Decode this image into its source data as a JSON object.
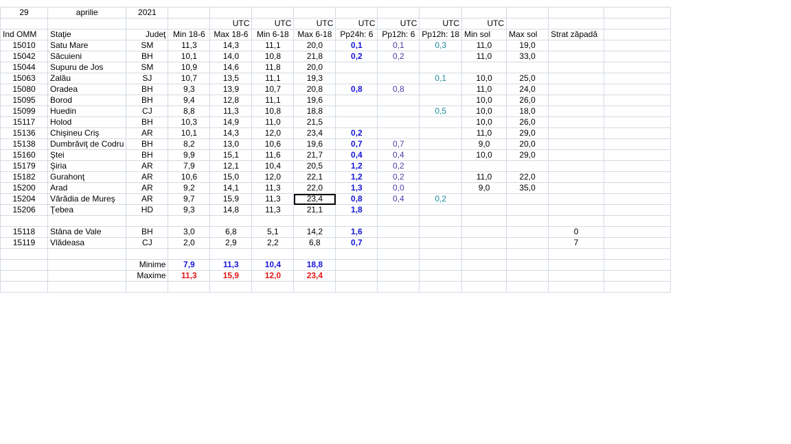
{
  "date": {
    "day": "29",
    "month": "aprilie",
    "year": "2021"
  },
  "utc_label": "UTC",
  "headers": [
    "Ind OMM",
    "Staţie",
    "Judeţ",
    "Min 18-6",
    "Max 18-6",
    "Min 6-18",
    "Max 6-18",
    "Pp24h: 6",
    "Pp12h: 6",
    "Pp12h: 18",
    "Min sol",
    "Max sol",
    "Strat zăpadă"
  ],
  "rows": [
    {
      "id": "15010",
      "station": "Satu Mare",
      "county": "SM",
      "min186": "11,3",
      "max186": "14,3",
      "min618": "11,1",
      "max618": "20,0",
      "pp24": "0,1",
      "pp12a": "0,1",
      "pp12b": "0,3",
      "minsol": "11,0",
      "maxsol": "19,0",
      "snow": ""
    },
    {
      "id": "15042",
      "station": "Săcuieni",
      "county": "BH",
      "min186": "10,1",
      "max186": "14,0",
      "min618": "10,8",
      "max618": "21,8",
      "pp24": "0,2",
      "pp12a": "0,2",
      "pp12b": "",
      "minsol": "11,0",
      "maxsol": "33,0",
      "snow": ""
    },
    {
      "id": "15044",
      "station": "Supuru de Jos",
      "county": "SM",
      "min186": "10,9",
      "max186": "14,6",
      "min618": "11,8",
      "max618": "20,0",
      "pp24": "",
      "pp12a": "",
      "pp12b": "",
      "minsol": "",
      "maxsol": "",
      "snow": ""
    },
    {
      "id": "15063",
      "station": "Zalău",
      "county": "SJ",
      "min186": "10,7",
      "max186": "13,5",
      "min618": "11,1",
      "max618": "19,3",
      "pp24": "",
      "pp12a": "",
      "pp12b": "0,1",
      "minsol": "10,0",
      "maxsol": "25,0",
      "snow": ""
    },
    {
      "id": "15080",
      "station": "Oradea",
      "county": "BH",
      "min186": "9,3",
      "max186": "13,9",
      "min618": "10,7",
      "max618": "20,8",
      "pp24": "0,8",
      "pp12a": "0,8",
      "pp12b": "",
      "minsol": "11,0",
      "maxsol": "24,0",
      "snow": ""
    },
    {
      "id": "15095",
      "station": "Borod",
      "county": "BH",
      "min186": "9,4",
      "max186": "12,8",
      "min618": "11,1",
      "max618": "19,6",
      "pp24": "",
      "pp12a": "",
      "pp12b": "",
      "minsol": "10,0",
      "maxsol": "26,0",
      "snow": ""
    },
    {
      "id": "15099",
      "station": "Huedin",
      "county": "CJ",
      "min186": "8,8",
      "max186": "11,3",
      "min618": "10,8",
      "max618": "18,8",
      "pp24": "",
      "pp12a": "",
      "pp12b": "0,5",
      "minsol": "10,0",
      "maxsol": "18,0",
      "snow": ""
    },
    {
      "id": "15117",
      "station": "Holod",
      "county": "BH",
      "min186": "10,3",
      "max186": "14,9",
      "min618": "11,0",
      "max618": "21,5",
      "pp24": "",
      "pp12a": "",
      "pp12b": "",
      "minsol": "10,0",
      "maxsol": "26,0",
      "snow": ""
    },
    {
      "id": "15136",
      "station": "Chişineu   Criş",
      "county": "AR",
      "min186": "10,1",
      "max186": "14,3",
      "min618": "12,0",
      "max618": "23,4",
      "pp24": "0,2",
      "pp12a": "",
      "pp12b": "",
      "minsol": "11,0",
      "maxsol": "29,0",
      "snow": ""
    },
    {
      "id": "15138",
      "station": "Dumbrăviţ  de Codru",
      "county": "BH",
      "min186": "8,2",
      "max186": "13,0",
      "min618": "10,6",
      "max618": "19,6",
      "pp24": "0,7",
      "pp12a": "0,7",
      "pp12b": "",
      "minsol": "9,0",
      "maxsol": "20,0",
      "snow": ""
    },
    {
      "id": "15160",
      "station": "Ştei",
      "county": "BH",
      "min186": "9,9",
      "max186": "15,1",
      "min618": "11,6",
      "max618": "21,7",
      "pp24": "0,4",
      "pp12a": "0,4",
      "pp12b": "",
      "minsol": "10,0",
      "maxsol": "29,0",
      "snow": ""
    },
    {
      "id": "15179",
      "station": "Şiria",
      "county": "AR",
      "min186": "7,9",
      "max186": "12,1",
      "min618": "10,4",
      "max618": "20,5",
      "pp24": "1,2",
      "pp12a": "0,2",
      "pp12b": "",
      "minsol": "",
      "maxsol": "",
      "snow": ""
    },
    {
      "id": "15182",
      "station": "Gurahonţ",
      "county": "AR",
      "min186": "10,6",
      "max186": "15,0",
      "min618": "12,0",
      "max618": "22,1",
      "pp24": "1,2",
      "pp12a": "0,2",
      "pp12b": "",
      "minsol": "11,0",
      "maxsol": "22,0",
      "snow": ""
    },
    {
      "id": "15200",
      "station": "Arad",
      "county": "AR",
      "min186": "9,2",
      "max186": "14,1",
      "min618": "11,3",
      "max618": "22,0",
      "pp24": "1,3",
      "pp12a": "0,0",
      "pp12b": "",
      "minsol": "9,0",
      "maxsol": "35,0",
      "snow": ""
    },
    {
      "id": "15204",
      "station": "Vărădia de Mureş",
      "county": "AR",
      "min186": "9,7",
      "max186": "15,9",
      "min618": "11,3",
      "max618": "23,4",
      "pp24": "0,8",
      "pp12a": "0,4",
      "pp12b": "0,2",
      "minsol": "",
      "maxsol": "",
      "snow": ""
    },
    {
      "id": "15206",
      "station": "Ţebea",
      "county": "HD",
      "min186": "9,3",
      "max186": "14,8",
      "min618": "11,3",
      "max618": "21,1",
      "pp24": "1,8",
      "pp12a": "",
      "pp12b": "",
      "minsol": "",
      "maxsol": "",
      "snow": ""
    },
    {
      "id": "",
      "station": "",
      "county": "",
      "min186": "",
      "max186": "",
      "min618": "",
      "max618": "",
      "pp24": "",
      "pp12a": "",
      "pp12b": "",
      "minsol": "",
      "maxsol": "",
      "snow": ""
    },
    {
      "id": "15118",
      "station": "Stâna de Vale",
      "county": "BH",
      "min186": "3,0",
      "max186": "6,8",
      "min618": "5,1",
      "max618": "14,2",
      "pp24": "1,6",
      "pp12a": "",
      "pp12b": "",
      "minsol": "",
      "maxsol": "",
      "snow": "0"
    },
    {
      "id": "15119",
      "station": "Vlădeasa",
      "county": "CJ",
      "min186": "2,0",
      "max186": "2,9",
      "min618": "2,2",
      "max618": "6,8",
      "pp24": "0,7",
      "pp12a": "",
      "pp12b": "",
      "minsol": "",
      "maxsol": "",
      "snow": "7"
    }
  ],
  "minime": {
    "label": "Minime",
    "values": [
      "7,9",
      "11,3",
      "10,4",
      "18,8"
    ]
  },
  "maxime": {
    "label": "Maxime",
    "values": [
      "11,3",
      "15,9",
      "12,0",
      "23,4"
    ]
  },
  "colors": {
    "grid": "#d3dae3",
    "bold_blue": "#1414d9",
    "purple": "#4b3aa8",
    "teal": "#1a8a9c",
    "red": "#e01414"
  }
}
